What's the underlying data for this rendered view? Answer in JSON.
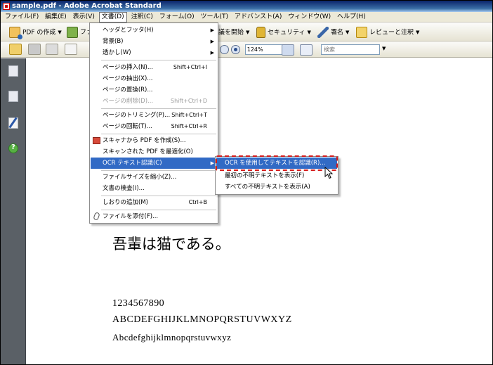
{
  "window": {
    "title": "sample.pdf - Adobe Acrobat Standard"
  },
  "menubar": {
    "items": [
      "ファイル(F)",
      "編集(E)",
      "表示(V)",
      "文書(D)",
      "注釈(C)",
      "フォーム(O)",
      "ツール(T)",
      "アドバンスト(A)",
      "ウィンドウ(W)",
      "ヘルプ(H)"
    ],
    "active": "文書(D)"
  },
  "toolbar": {
    "create_pdf": "PDF の作成",
    "fa_partial": "ファ",
    "review_start": "議を開始",
    "security": "セキュリティ",
    "sign": "署名",
    "review_comment": "レビューと注釈"
  },
  "toolbar2": {
    "zoom": "124%",
    "search_placeholder": "検索"
  },
  "document_menu": {
    "items": [
      {
        "label": "ヘッダとフッタ(H)",
        "shortcut": "",
        "submenu": true,
        "disabled": false
      },
      {
        "label": "背景(B)",
        "shortcut": "",
        "submenu": true,
        "disabled": false
      },
      {
        "label": "透かし(W)",
        "shortcut": "",
        "submenu": true,
        "disabled": false
      },
      {
        "label": "ページの挿入(N)...",
        "shortcut": "Shift+Ctrl+I",
        "submenu": false,
        "disabled": false
      },
      {
        "label": "ページの抽出(X)...",
        "shortcut": "",
        "submenu": false,
        "disabled": false
      },
      {
        "label": "ページの置換(R)...",
        "shortcut": "",
        "submenu": false,
        "disabled": false
      },
      {
        "label": "ページの削除(D)...",
        "shortcut": "Shift+Ctrl+D",
        "submenu": false,
        "disabled": true
      },
      {
        "label": "ページのトリミング(P)...",
        "shortcut": "Shift+Ctrl+T",
        "submenu": false,
        "disabled": false
      },
      {
        "label": "ページの回転(T)...",
        "shortcut": "Shift+Ctrl+R",
        "submenu": false,
        "disabled": false
      },
      {
        "label": "スキャナから PDF を作成(S)...",
        "shortcut": "",
        "submenu": false,
        "disabled": false
      },
      {
        "label": "スキャンされた PDF を最適化(O)",
        "shortcut": "",
        "submenu": false,
        "disabled": false
      },
      {
        "label": "OCR テキスト認識(C)",
        "shortcut": "",
        "submenu": true,
        "disabled": false
      },
      {
        "label": "ファイルサイズを縮小(Z)...",
        "shortcut": "",
        "submenu": false,
        "disabled": false
      },
      {
        "label": "文書の検査(I)...",
        "shortcut": "",
        "submenu": false,
        "disabled": false
      },
      {
        "label": "しおりの追加(M)",
        "shortcut": "Ctrl+B",
        "submenu": false,
        "disabled": false
      },
      {
        "label": "ファイルを添付(F)...",
        "shortcut": "",
        "submenu": false,
        "disabled": false
      }
    ]
  },
  "ocr_submenu": {
    "items": [
      "OCR を使用してテキストを認識(R)...",
      "最初の不明テキストを表示(F)",
      "すべての不明テキストを表示(A)"
    ]
  },
  "document": {
    "line1": "吾輩は猫である。",
    "line2": "1234567890",
    "line3": "ABCDEFGHIJKLMNOPQRSTUVWXYZ",
    "line4": "Abcdefghijklmnopqrstuvwxyz"
  },
  "colors": {
    "highlight": "#316ac5",
    "callout": "#d41a1a",
    "sidebar": "#5a6066"
  }
}
